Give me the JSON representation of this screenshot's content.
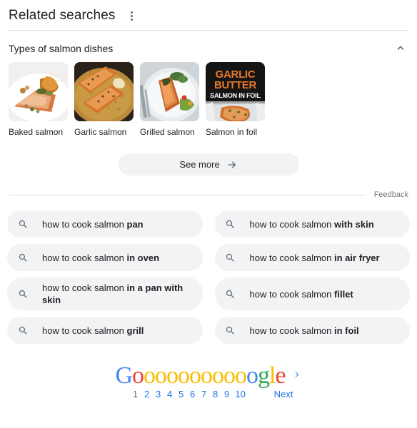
{
  "header": {
    "title": "Related searches",
    "menu_icon": "kebab-menu-icon"
  },
  "section": {
    "title": "Types of salmon dishes",
    "collapse_icon": "chevron-up-icon"
  },
  "thumbnails": [
    {
      "label": "Baked salmon",
      "alt": "baked salmon fillet on white plate"
    },
    {
      "label": "Garlic salmon",
      "alt": "garlic salmon fillets in pan"
    },
    {
      "label": "Grilled salmon",
      "alt": "grilled salmon with rice and salad"
    },
    {
      "label": "Salmon in foil",
      "alt": "garlic butter salmon in foil recipe card"
    }
  ],
  "see_more": {
    "label": "See more",
    "icon": "arrow-right-icon"
  },
  "feedback": {
    "label": "Feedback"
  },
  "suggestions": [
    {
      "prefix": "how to cook salmon ",
      "bold": "pan",
      "icon": "search-icon"
    },
    {
      "prefix": "how to cook salmon ",
      "bold": "with skin",
      "icon": "search-icon"
    },
    {
      "prefix": "how to cook salmon ",
      "bold": "in oven",
      "icon": "search-icon"
    },
    {
      "prefix": "how to cook salmon ",
      "bold": "in air fryer",
      "icon": "search-icon"
    },
    {
      "prefix": "how to cook salmon ",
      "bold": "in a pan with skin",
      "icon": "search-icon"
    },
    {
      "prefix": "how to cook salmon ",
      "bold": "fillet",
      "icon": "search-icon"
    },
    {
      "prefix": "how to cook salmon ",
      "bold": "grill",
      "icon": "search-icon"
    },
    {
      "prefix": "how to cook salmon ",
      "bold": "in foil",
      "icon": "search-icon"
    }
  ],
  "pagination": {
    "logo_letters": [
      {
        "ch": "G",
        "color": "#4285f4"
      },
      {
        "ch": "o",
        "color": "#ea4335"
      },
      {
        "ch": "o",
        "color": "#fbbc05"
      },
      {
        "ch": "o",
        "color": "#fbbc05"
      },
      {
        "ch": "o",
        "color": "#fbbc05"
      },
      {
        "ch": "o",
        "color": "#fbbc05"
      },
      {
        "ch": "o",
        "color": "#fbbc05"
      },
      {
        "ch": "o",
        "color": "#fbbc05"
      },
      {
        "ch": "o",
        "color": "#fbbc05"
      },
      {
        "ch": "o",
        "color": "#fbbc05"
      },
      {
        "ch": "o",
        "color": "#fbbc05"
      },
      {
        "ch": "o",
        "color": "#4285f4"
      },
      {
        "ch": "g",
        "color": "#34a853"
      },
      {
        "ch": "l",
        "color": "#fbbc05"
      },
      {
        "ch": "e",
        "color": "#ea4335"
      }
    ],
    "next_chevron_icon": "chevron-right-icon",
    "pages": [
      "1",
      "2",
      "3",
      "4",
      "5",
      "6",
      "7",
      "8",
      "9",
      "10"
    ],
    "current_page": "1",
    "next_label": "Next"
  },
  "colors": {
    "chip_bg": "#f1f3f4",
    "link_blue": "#1a73e8",
    "text": "#202124",
    "muted": "#70757a",
    "divider": "#dadce0"
  }
}
